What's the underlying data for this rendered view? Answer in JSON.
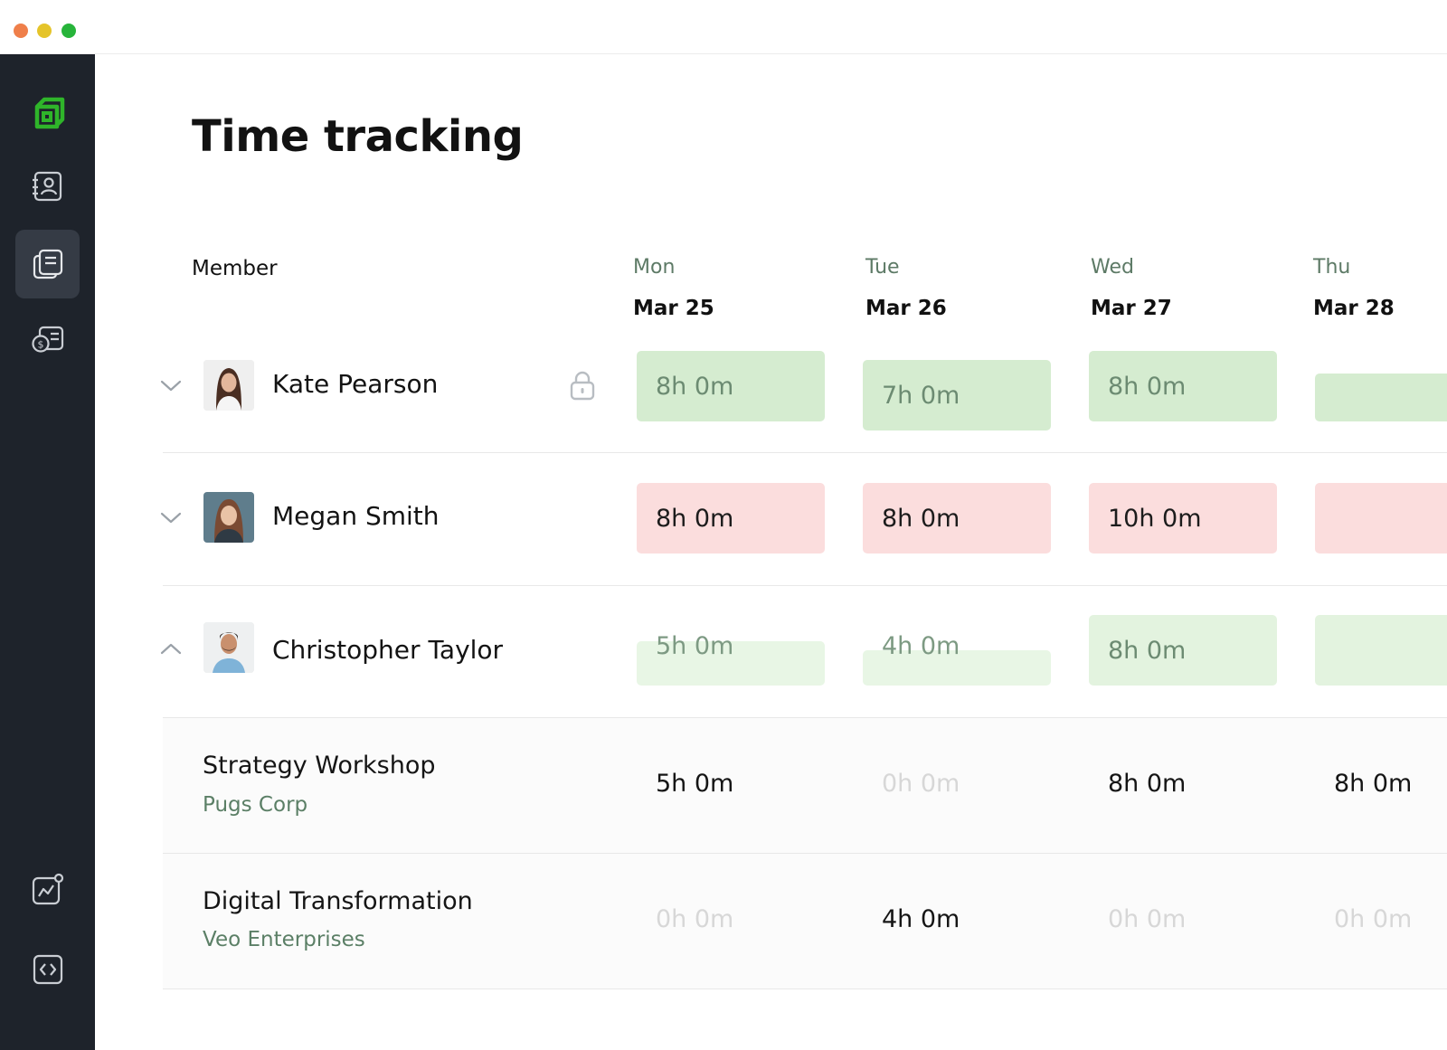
{
  "window": {
    "controls": [
      "close",
      "minimize",
      "maximize"
    ]
  },
  "sidebar": {
    "items": [
      {
        "icon": "logo-icon"
      },
      {
        "icon": "contacts-icon"
      },
      {
        "icon": "timesheet-icon",
        "active": true
      },
      {
        "icon": "billing-icon"
      },
      {
        "icon": "reports-icon"
      },
      {
        "icon": "code-icon"
      }
    ]
  },
  "page": {
    "title": "Time tracking"
  },
  "table": {
    "member_header": "Member",
    "days": [
      {
        "name": "Mon",
        "date": "Mar 25"
      },
      {
        "name": "Tue",
        "date": "Mar 26"
      },
      {
        "name": "Wed",
        "date": "Mar 27"
      },
      {
        "name": "Thu",
        "date": "Mar 28"
      }
    ],
    "members": [
      {
        "name": "Kate Pearson",
        "expanded": false,
        "locked": true,
        "status": "approved",
        "hours": [
          "8h 0m",
          "7h 0m",
          "8h 0m",
          ""
        ]
      },
      {
        "name": "Megan Smith",
        "expanded": false,
        "locked": false,
        "status": "over",
        "hours": [
          "8h 0m",
          "8h 0m",
          "10h 0m",
          ""
        ]
      },
      {
        "name": "Christopher Taylor",
        "expanded": true,
        "locked": false,
        "status": "partial",
        "hours": [
          "5h 0m",
          "4h 0m",
          "8h 0m",
          ""
        ]
      }
    ],
    "projects": [
      {
        "name": "Strategy Workshop",
        "client": "Pugs Corp",
        "hours": [
          "5h 0m",
          "0h 0m",
          "8h 0m",
          "8h 0m"
        ]
      },
      {
        "name": "Digital Transformation",
        "client": "Veo Enterprises",
        "hours": [
          "0h 0m",
          "4h 0m",
          "0h 0m",
          "0h 0m"
        ]
      }
    ]
  },
  "colors": {
    "sidebar_bg": "#1e232b",
    "accent_green": "#2fb52a",
    "cell_green": "#d5ecd0",
    "cell_red": "#fbdddd",
    "client_text": "#5b7f66"
  }
}
